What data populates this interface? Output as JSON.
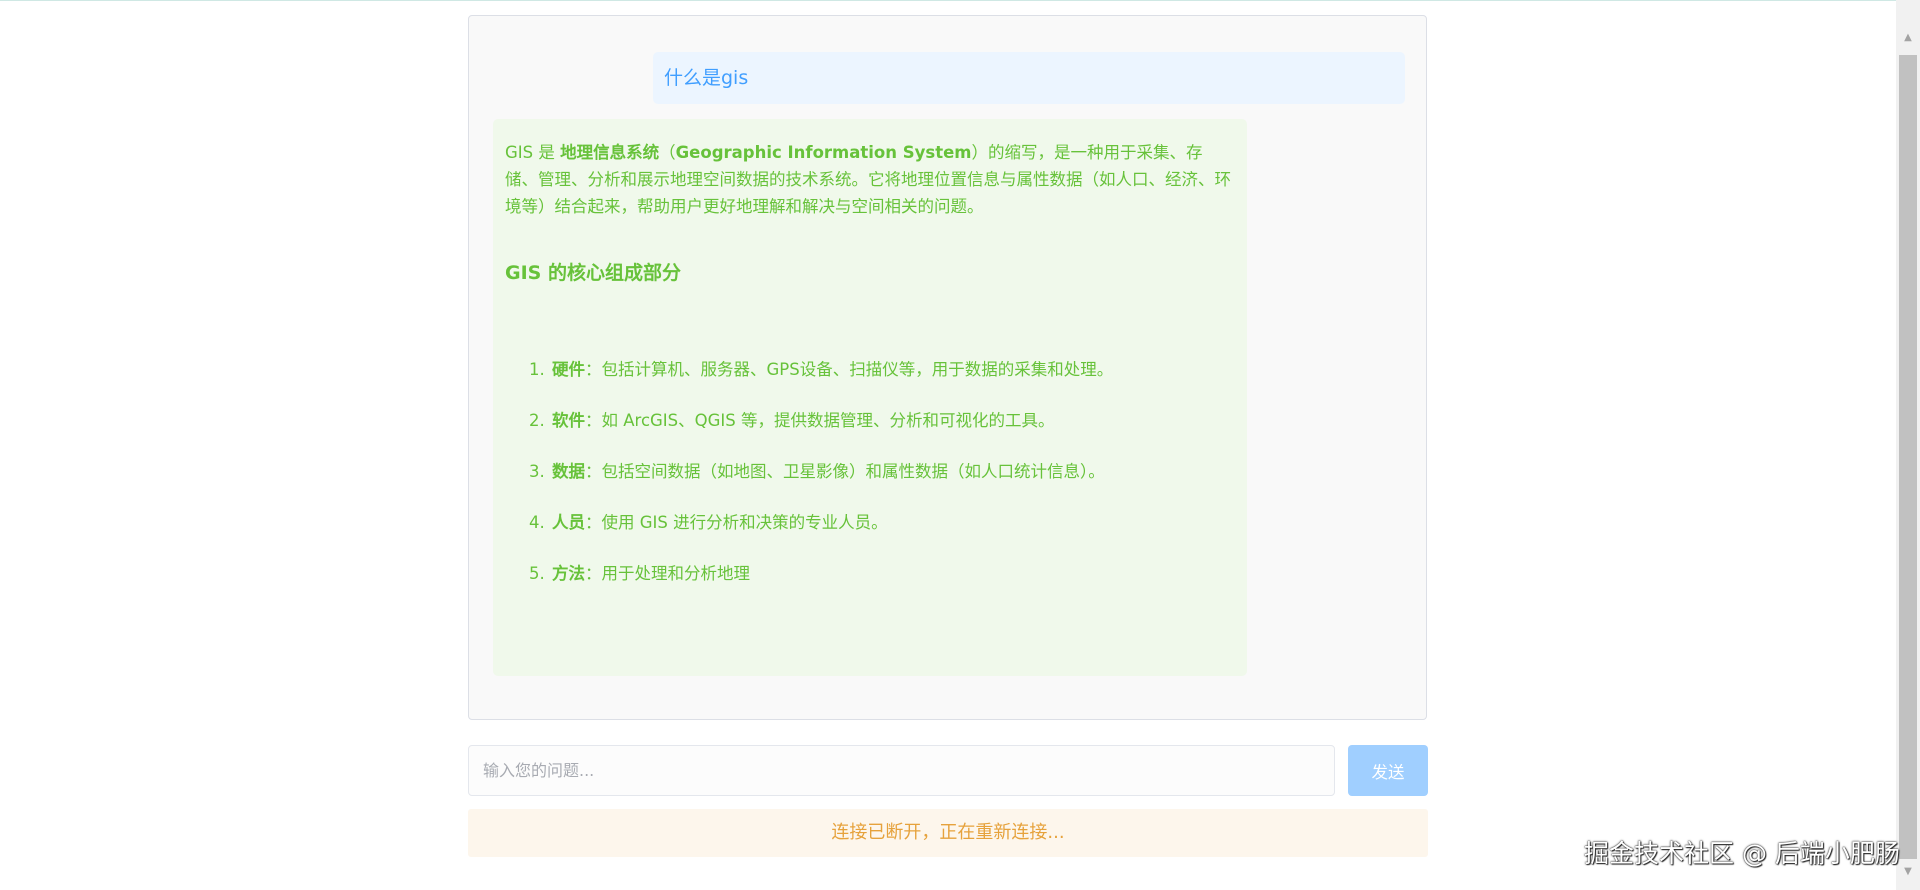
{
  "chat": {
    "user_message": "什么是gis",
    "bot_message": {
      "intro_prefix": "GIS 是 ",
      "intro_bold": "地理信息系统",
      "intro_paren_open": "（",
      "intro_bold_en": "Geographic Information System",
      "intro_rest": "）的缩写，是一种用于采集、存储、管理、分析和展示地理空间数据的技术系统。它将地理位置信息与属性数据（如人口、经济、环境等）结合起来，帮助用户更好地理解和解决与空间相关的问题。",
      "heading": "GIS 的核心组成部分",
      "items": [
        {
          "num": "1.",
          "term": "硬件",
          "desc": "：包括计算机、服务器、GPS设备、扫描仪等，用于数据的采集和处理。"
        },
        {
          "num": "2.",
          "term": "软件",
          "desc": "：如 ArcGIS、QGIS 等，提供数据管理、分析和可视化的工具。"
        },
        {
          "num": "3.",
          "term": "数据",
          "desc": "：包括空间数据（如地图、卫星影像）和属性数据（如人口统计信息）。"
        },
        {
          "num": "4.",
          "term": "人员",
          "desc": "：使用 GIS 进行分析和决策的专业人员。"
        },
        {
          "num": "5.",
          "term": "方法",
          "desc": "：用于处理和分析地理"
        }
      ]
    }
  },
  "input": {
    "placeholder": "输入您的问题...",
    "value": ""
  },
  "send_button": {
    "label": "发送"
  },
  "status": {
    "text": "连接已断开，正在重新连接..."
  },
  "watermark": {
    "text": "掘金技术社区 @ 后端小肥肠"
  },
  "colors": {
    "user_text": "#409eff",
    "user_bg": "#ecf5ff",
    "bot_text": "#67c23a",
    "bot_bg": "#f0f9eb",
    "send_button_bg": "#a0cfff",
    "status_text": "#e6a23c",
    "status_bg": "#fdf6ec"
  }
}
